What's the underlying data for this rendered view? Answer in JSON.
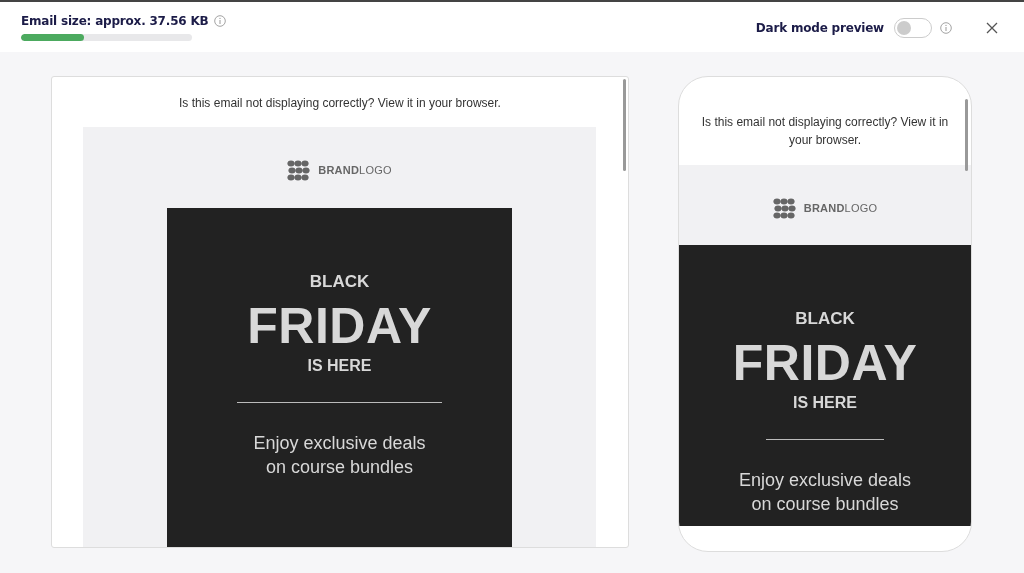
{
  "header": {
    "size_label": "Email size: approx. 37.56 KB",
    "size_meter": {
      "level": 0.37
    },
    "dark_mode": {
      "label": "Dark mode preview",
      "on": false
    }
  },
  "previews": [
    {
      "kind": "desktop",
      "notice": "Is this email not displaying correctly? View it in your browser.",
      "logo": "**BRAND**LOGO",
      "eyebrow": "BLACK",
      "title": "FRIDAY",
      "subtitle": "IS HERE",
      "body": "Enjoy exclusive deals on course bundles"
    },
    {
      "kind": "mobile",
      "notice": "Is this email not displaying correctly? View it in your browser.",
      "logo": "**BRAND**LOGO",
      "eyebrow": "BLACK",
      "title": "FRIDAY",
      "subtitle": "IS HERE",
      "body": "Enjoy exclusive deals on course bundles"
    }
  ]
}
